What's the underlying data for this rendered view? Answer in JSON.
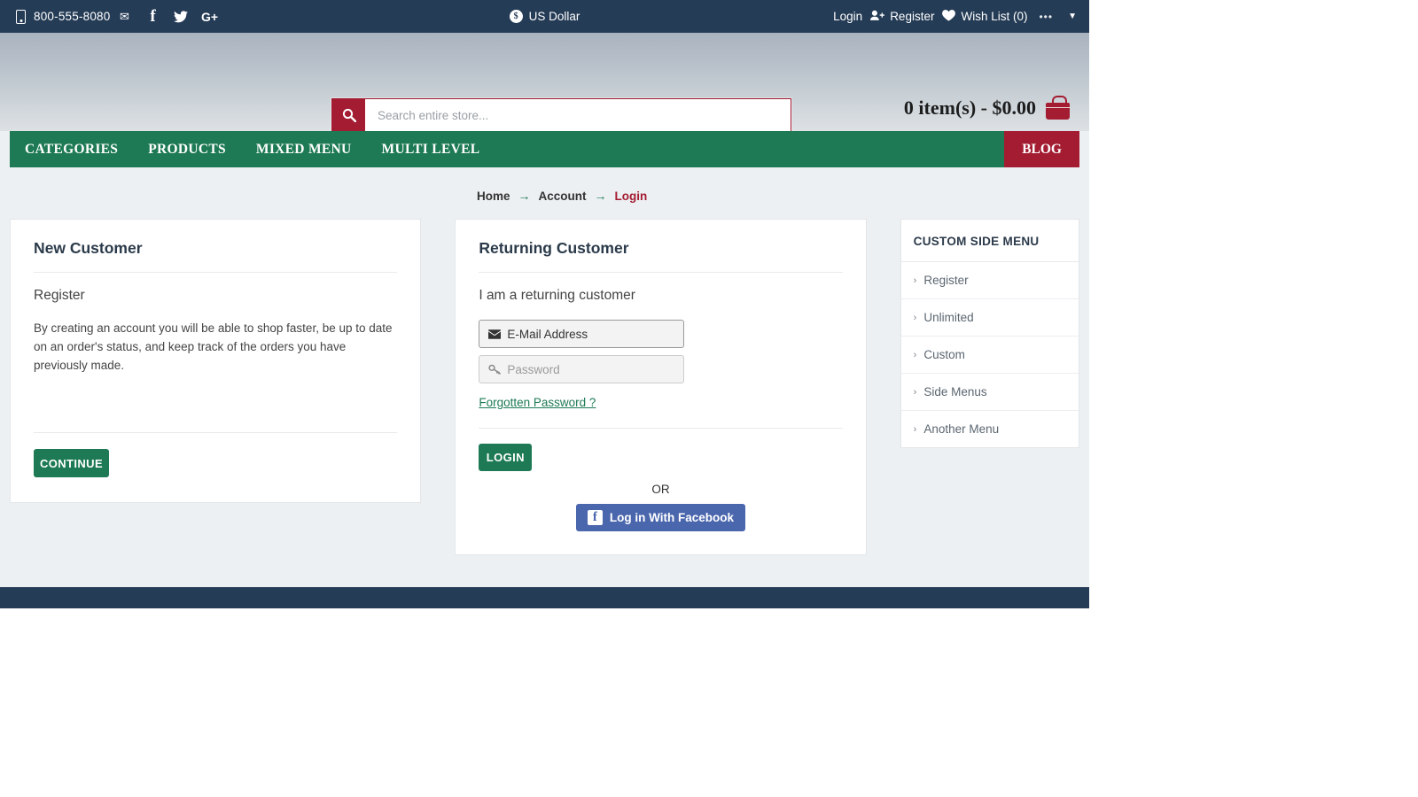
{
  "topbar": {
    "phone": "800-555-8080",
    "phone_icon": "mobile-phone-icon",
    "social": [
      {
        "name": "email-icon",
        "glyph": "✉"
      },
      {
        "name": "facebook-icon",
        "glyph": "f"
      },
      {
        "name": "twitter-icon",
        "glyph": "🐦"
      },
      {
        "name": "google-plus-icon",
        "glyph": "G+"
      }
    ],
    "currency_symbol": "$",
    "currency": "US Dollar",
    "login": "Login",
    "register": "Register",
    "wishlist": "Wish List (0)",
    "dots": "•••",
    "caret": "▼"
  },
  "header": {
    "search_placeholder": "Search entire store...",
    "search_value": "",
    "cart_text": "0 item(s) - $0.00"
  },
  "nav": {
    "items": [
      {
        "label": "CATEGORIES"
      },
      {
        "label": "PRODUCTS"
      },
      {
        "label": "MIXED MENU"
      },
      {
        "label": "MULTI LEVEL"
      }
    ],
    "blog": "BLOG"
  },
  "breadcrumb": {
    "home": "Home",
    "account": "Account",
    "current": "Login",
    "arrow": "→"
  },
  "new_customer": {
    "title": "New Customer",
    "subhead": "Register",
    "body": "By creating an account you will be able to shop faster, be up to date on an order's status, and keep track of the orders you have previously made.",
    "continue_label": "CONTINUE"
  },
  "returning_customer": {
    "title": "Returning Customer",
    "subhead": "I am a returning customer",
    "email_placeholder": "E-Mail Address",
    "email_value": "E-Mail Address",
    "password_placeholder": "Password",
    "password_value": "",
    "forgotten": "Forgotten Password ?",
    "login_label": "LOGIN",
    "or_label": "OR",
    "facebook_label": "Log in With Facebook"
  },
  "sidebar": {
    "title": "CUSTOM SIDE MENU",
    "items": [
      {
        "label": "Register"
      },
      {
        "label": "Unlimited"
      },
      {
        "label": "Custom"
      },
      {
        "label": "Side Menus"
      },
      {
        "label": "Another Menu"
      }
    ],
    "chevron": "›"
  },
  "colors": {
    "topbar": "#253c56",
    "accent_green": "#1d7a54",
    "accent_red": "#a41c32",
    "facebook_blue": "#4a66ad",
    "page_bg": "#ecf0f2"
  }
}
